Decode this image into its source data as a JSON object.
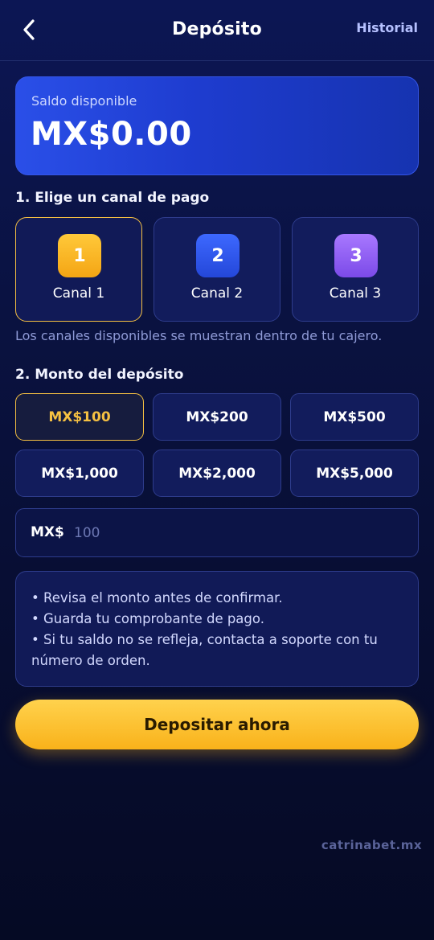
{
  "header": {
    "title": "Depósito",
    "history_label": "Historial",
    "back_icon": "chevron-left-icon"
  },
  "balance": {
    "label": "Saldo disponible",
    "amount": "MX$0.00"
  },
  "channels_section": {
    "title": "1. Elige un canal de pago",
    "items": [
      {
        "badge": "1",
        "label": "Canal 1",
        "color": "#f7b21b",
        "selected": true
      },
      {
        "badge": "2",
        "label": "Canal 2",
        "color": "#2f55ee",
        "selected": false
      },
      {
        "badge": "3",
        "label": "Canal 3",
        "color": "#8b5cf6",
        "selected": false
      }
    ],
    "note": "Los canales disponibles se muestran dentro de tu cajero."
  },
  "amount_section": {
    "title": "2. Monto del depósito",
    "options": [
      "MX$100",
      "MX$200",
      "MX$500",
      "MX$1,000",
      "MX$2,000",
      "MX$5,000"
    ],
    "selected_index": 0,
    "input_prefix": "MX$",
    "input_placeholder": "100"
  },
  "tips": [
    "• Revisa el monto antes de confirmar.",
    "• Guarda tu comprobante de pago.",
    "• Si tu saldo no se refleja, contacta a soporte con tu número de orden."
  ],
  "deposit_button": "Depositar ahora",
  "watermark": "catrinabet.mx",
  "colors": {
    "accent": "#f5c042",
    "card": "#121c5c",
    "balance_card": "#2a4fe8"
  }
}
